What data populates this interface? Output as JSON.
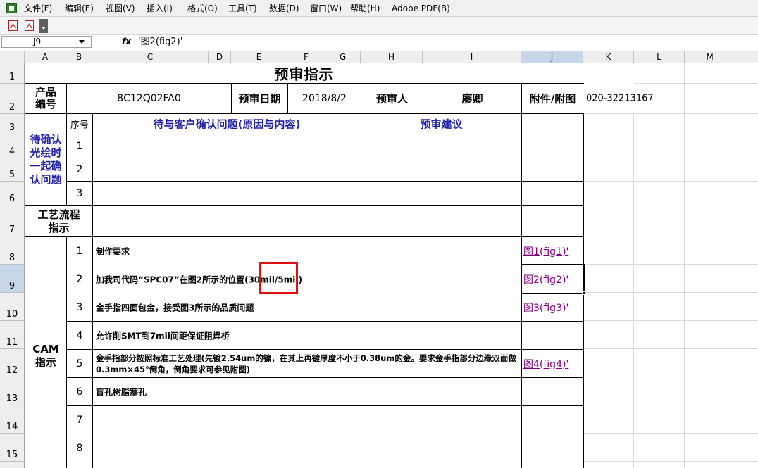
{
  "menu": {
    "items": [
      "文件(F)",
      "编辑(E)",
      "视图(V)",
      "插入(I)",
      "格式(O)",
      "工具(T)",
      "数据(D)",
      "窗口(W)",
      "帮助(H)",
      "Adobe PDF(B)"
    ]
  },
  "formula_bar": {
    "cell_ref": "J9",
    "fx": "fx",
    "formula": "'图2(fig2)'"
  },
  "columns": [
    "A",
    "B",
    "C",
    "D",
    "E",
    "F",
    "G",
    "H",
    "I",
    "J",
    "K",
    "L",
    "M"
  ],
  "rows": [
    "1",
    "2",
    "3",
    "4",
    "5",
    "6",
    "7",
    "8",
    "9",
    "10",
    "11",
    "12",
    "13",
    "14",
    "15"
  ],
  "sheet": {
    "title": "预审指示",
    "product_no_label": "产品\n编号",
    "product_no": "8C12Q02FA0",
    "review_date_label": "预审日期",
    "review_date": "2018/8/2",
    "reviewer_label": "预审人",
    "reviewer": "廖卿",
    "attachment_label": "附件/附图",
    "phone": "020-32213167",
    "pending_label": "待确认光绘时一起确认问题",
    "seq_label": "序号",
    "issue_header": "待与客户确认问题(原因与内容)",
    "suggest_header": "预审建议",
    "pending_rows": [
      "1",
      "2",
      "3"
    ],
    "process_label": "工艺流程\n指示",
    "cam_label": "CAM\n指示",
    "cam_rows": [
      {
        "no": "1",
        "text": "制作要求",
        "link": "图1(fig1)'"
      },
      {
        "no": "2",
        "text": "加我司代码“SPC07”在图2所示的位置(30mil/5mil)",
        "link": "图2(fig2)'"
      },
      {
        "no": "3",
        "text": "金手指四面包金，接受图3所示的品质问题",
        "link": "图3(fig3)'"
      },
      {
        "no": "4",
        "text": "允许削SMT到7mil间距保证阻焊桥",
        "link": ""
      },
      {
        "no": "5",
        "text": "金手指部分按照标准工艺处理(先镀2.54um的镍，在其上再镀厚度不小于0.38um的金。要求金手指部分边缘双面做0.3mm×45°倒角，倒角要求可参见附图)",
        "link": "图4(fig4)'"
      },
      {
        "no": "6",
        "text": "盲孔树脂塞孔",
        "link": ""
      },
      {
        "no": "7",
        "text": "",
        "link": ""
      },
      {
        "no": "8",
        "text": "",
        "link": ""
      }
    ]
  }
}
